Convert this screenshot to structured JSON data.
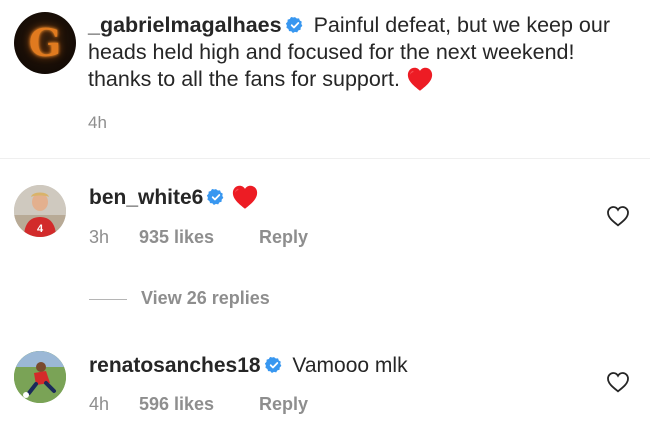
{
  "caption": {
    "username": "_gabrielmagalhaes",
    "text": "Painful defeat, but we keep our heads held high and focused for the next weekend!  thanks to all the fans for support.",
    "time": "4h",
    "avatar_letter": "G"
  },
  "comments": [
    {
      "username": "ben_white6",
      "text": "",
      "time": "3h",
      "likes": "935 likes",
      "reply": "Reply",
      "view_replies": "View 26 replies"
    },
    {
      "username": "renatosanches18",
      "text": "Vamooo mlk",
      "time": "4h",
      "likes": "596 likes",
      "reply": "Reply"
    }
  ],
  "colors": {
    "verified": "#3897f0",
    "heart": "#ed4956",
    "secondary_text": "#8e8e8e",
    "primary_text": "#262626"
  },
  "icons": {
    "verified": "verified-badge-icon",
    "heart": "red-heart-emoji",
    "like": "heart-outline-icon"
  }
}
